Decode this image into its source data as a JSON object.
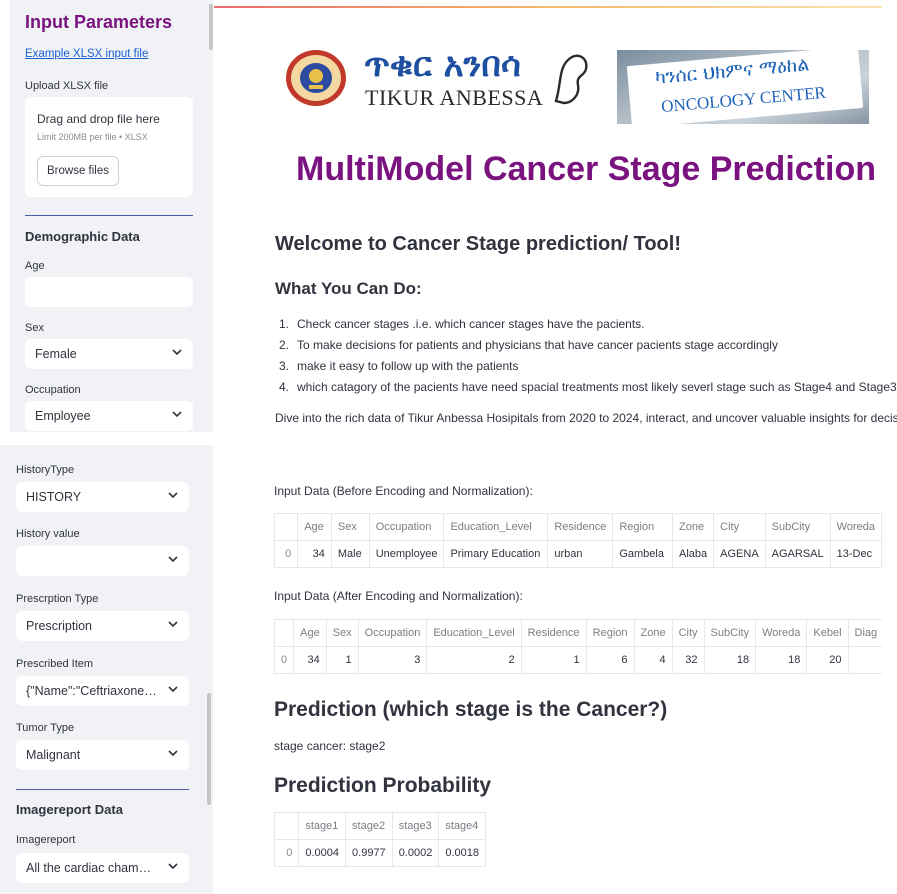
{
  "sidebar_top": {
    "title": "Input Parameters",
    "example_link": "Example XLSX input file",
    "upload_label": "Upload XLSX file",
    "dropzone_title": "Drag and drop file here",
    "dropzone_hint": "Limit 200MB per file • XLSX",
    "browse_label": "Browse files",
    "demographic_title": "Demographic Data",
    "age_label": "Age",
    "age_value": "",
    "sex_label": "Sex",
    "sex_value": "Female",
    "occupation_label": "Occupation",
    "occupation_value": "Employee"
  },
  "sidebar_bottom": {
    "history_type_label": "HistoryType",
    "history_type_value": "HISTORY",
    "history_value_label": "History value",
    "history_value_value": "",
    "prescription_type_label": "Prescrption Type",
    "prescription_type_value": "Prescription",
    "prescribed_item_label": "Prescribed Item",
    "prescribed_item_value": "{\"Name\":\"Ceftriaxone ...",
    "tumor_type_label": "Tumor Type",
    "tumor_type_value": "Malignant",
    "imagereport_title": "Imagereport Data",
    "imagereport_label": "Imagereport",
    "imagereport_value": "All the cardiac chambe..."
  },
  "header": {
    "logo_amharic": "ጥቁር አንበሳ",
    "logo_latin": "TIKUR ANBESSA",
    "sign_amharic": "ካንሰር ህክምና ማዕከል",
    "sign_latin": "ONCOLOGY CENTER",
    "app_title": "MultiModel Cancer Stage Prediction"
  },
  "welcome": {
    "title": "Welcome to Cancer Stage prediction/ Tool!",
    "subtitle": "What You Can Do:",
    "items": [
      "Check cancer stages .i.e. which cancer stages have the pacients.",
      "To make decisions for patients and physicians that have cancer pacients stage accordingly",
      "make it easy to follow up with the patients",
      "which catagory of the pacients have need spacial treatments most likely severl stage such as Stage4 and Stage3"
    ],
    "intro": "Dive into the rich data of Tikur Anbessa Hosipitals from 2020 to 2024, interact, and uncover valuable insights for decision"
  },
  "before_table": {
    "caption": "Input Data (Before Encoding and Normalization):",
    "columns": [
      "",
      "Age",
      "Sex",
      "Occupation",
      "Education_Level",
      "Residence",
      "Region",
      "Zone",
      "City",
      "SubCity",
      "Woreda"
    ],
    "row": [
      "0",
      "34",
      "Male",
      "Unemployee",
      "Primary Education",
      "urban",
      "Gambela",
      "Alaba",
      "AGENA",
      "AGARSAL",
      "13-Dec"
    ]
  },
  "after_table": {
    "caption": "Input Data (After Encoding and Normalization):",
    "columns": [
      "",
      "Age",
      "Sex",
      "Occupation",
      "Education_Level",
      "Residence",
      "Region",
      "Zone",
      "City",
      "SubCity",
      "Woreda",
      "Kebel",
      "Diag"
    ],
    "row": [
      "0",
      "34",
      "1",
      "3",
      "2",
      "1",
      "6",
      "4",
      "32",
      "18",
      "18",
      "20",
      ""
    ]
  },
  "prediction": {
    "title": "Prediction (which stage is the Cancer?)",
    "result": "stage cancer: stage2"
  },
  "probability": {
    "title": "Prediction Probability",
    "columns": [
      "",
      "stage1",
      "stage2",
      "stage3",
      "stage4"
    ],
    "row": [
      "0",
      "0.0004",
      "0.9977",
      "0.0002",
      "0.0018"
    ]
  }
}
